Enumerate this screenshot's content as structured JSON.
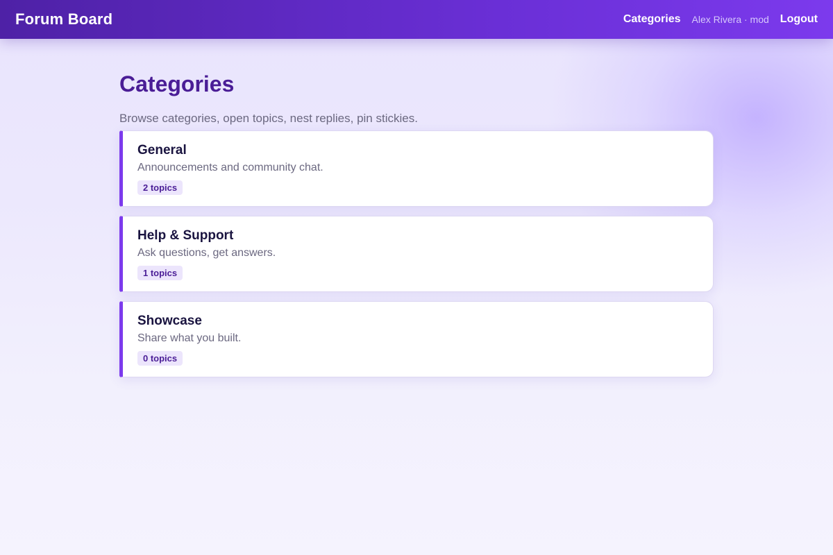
{
  "header": {
    "brand": "Forum Board",
    "nav_categories": "Categories",
    "user": "Alex Rivera · mod",
    "logout": "Logout"
  },
  "page": {
    "title": "Categories",
    "subtitle": "Browse categories, open topics, nest replies, pin stickies."
  },
  "categories": [
    {
      "name": "General",
      "description": "Announcements and community chat.",
      "topics": "2 topics"
    },
    {
      "name": "Help & Support",
      "description": "Ask questions, get answers.",
      "topics": "1 topics"
    },
    {
      "name": "Showcase",
      "description": "Share what you built.",
      "topics": "0 topics"
    }
  ],
  "colors": {
    "accent": "#7c3aed",
    "header_start": "#4e21a6",
    "title": "#4a1d96",
    "badge_bg": "#ece5fc"
  }
}
